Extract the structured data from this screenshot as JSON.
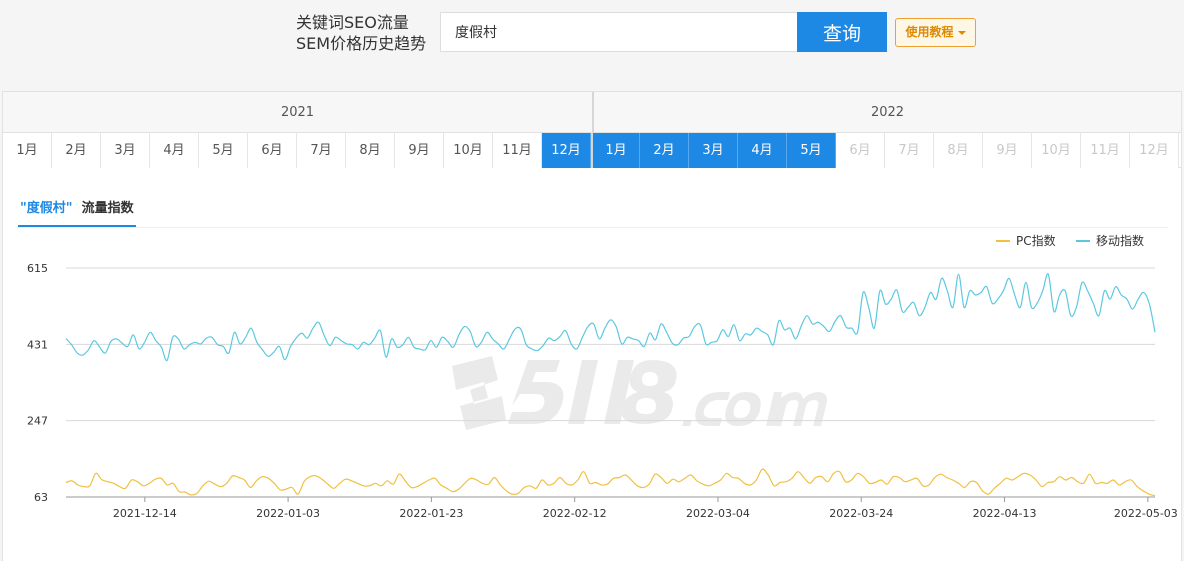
{
  "header": {
    "brand_line1": "关键词SEO流量",
    "brand_line2": "SEM价格历史趋势",
    "search_value": "度假村",
    "search_button": "查询",
    "tutorial_button": "使用教程"
  },
  "timeline": {
    "years": [
      "2021",
      "2022"
    ],
    "months_2021": [
      {
        "label": "1月",
        "state": "normal"
      },
      {
        "label": "2月",
        "state": "normal"
      },
      {
        "label": "3月",
        "state": "normal"
      },
      {
        "label": "4月",
        "state": "normal"
      },
      {
        "label": "5月",
        "state": "normal"
      },
      {
        "label": "6月",
        "state": "normal"
      },
      {
        "label": "7月",
        "state": "normal"
      },
      {
        "label": "8月",
        "state": "normal"
      },
      {
        "label": "9月",
        "state": "normal"
      },
      {
        "label": "10月",
        "state": "normal"
      },
      {
        "label": "11月",
        "state": "normal"
      },
      {
        "label": "12月",
        "state": "active"
      }
    ],
    "months_2022": [
      {
        "label": "1月",
        "state": "active"
      },
      {
        "label": "2月",
        "state": "active"
      },
      {
        "label": "3月",
        "state": "active"
      },
      {
        "label": "4月",
        "state": "active"
      },
      {
        "label": "5月",
        "state": "active"
      },
      {
        "label": "6月",
        "state": "disabled"
      },
      {
        "label": "7月",
        "state": "disabled"
      },
      {
        "label": "8月",
        "state": "disabled"
      },
      {
        "label": "9月",
        "state": "disabled"
      },
      {
        "label": "10月",
        "state": "disabled"
      },
      {
        "label": "11月",
        "state": "disabled"
      },
      {
        "label": "12月",
        "state": "disabled"
      }
    ]
  },
  "tab": {
    "keyword": "\"度假村\"",
    "label": "流量指数"
  },
  "colors": {
    "accent": "#1e88e5",
    "pc": "#f0c040",
    "mobile": "#5bc8e0"
  },
  "chart_data": {
    "type": "line",
    "title": "",
    "xlabel": "",
    "ylabel": "",
    "x_start": "2021-12-03",
    "x_end": "2022-05-04",
    "x_tick_labels": [
      "2021-12-14",
      "2022-01-03",
      "2022-01-23",
      "2022-02-12",
      "2022-03-04",
      "2022-03-24",
      "2022-04-13",
      "2022-05-03"
    ],
    "y_tick_labels": [
      "63",
      "247",
      "431",
      "615"
    ],
    "ylim": [
      63,
      615
    ],
    "grid": true,
    "legend_position": "top-right",
    "series": [
      {
        "name": "PC指数",
        "color": "#f0c040",
        "values": [
          98,
          102,
          92,
          88,
          90,
          120,
          105,
          100,
          96,
          88,
          84,
          104,
          100,
          90,
          96,
          106,
          108,
          92,
          96,
          76,
          75,
          68,
          72,
          90,
          101,
          94,
          88,
          96,
          114,
          110,
          104,
          86,
          102,
          112,
          108,
          96,
          80,
          82,
          86,
          70,
          100,
          112,
          114,
          106,
          94,
          84,
          96,
          106,
          102,
          96,
          90,
          90,
          96,
          90,
          102,
          94,
          118,
          102,
          86,
          88,
          96,
          104,
          108,
          92,
          84,
          76,
          82,
          96,
          108,
          104,
          96,
          94,
          110,
          92,
          78,
          70,
          72,
          86,
          90,
          84,
          104,
          92,
          96,
          110,
          96,
          92,
          104,
          124,
          96,
          98,
          92,
          94,
          108,
          110,
          116,
          104,
          90,
          86,
          94,
          118,
          110,
          96,
          106,
          100,
          108,
          116,
          102,
          94,
          90,
          96,
          104,
          120,
          110,
          108,
          96,
          92,
          104,
          130,
          116,
          90,
          98,
          100,
          108,
          124,
          110,
          96,
          110,
          112,
          100,
          120,
          124,
          100,
          104,
          120,
          112,
          96,
          98,
          104,
          94,
          112,
          110,
          100,
          104,
          108,
          90,
          92,
          110,
          118,
          110,
          104,
          96,
          86,
          100,
          98,
          78,
          70,
          84,
          96,
          108,
          104,
          112,
          120,
          116,
          104,
          88,
          98,
          100,
          112,
          104,
          110,
          100,
          96,
          118,
          96,
          98,
          96,
          104,
          92,
          100,
          104,
          88,
          78,
          70,
          66
        ]
      },
      {
        "name": "移动指数",
        "color": "#5bc8e0",
        "values": [
          445,
          430,
          410,
          405,
          418,
          440,
          424,
          410,
          438,
          444,
          434,
          426,
          454,
          420,
          436,
          460,
          440,
          424,
          392,
          448,
          444,
          420,
          430,
          436,
          432,
          446,
          448,
          430,
          426,
          410,
          460,
          432,
          448,
          470,
          436,
          418,
          402,
          412,
          426,
          394,
          426,
          446,
          458,
          446,
          470,
          484,
          452,
          428,
          448,
          440,
          432,
          430,
          420,
          436,
          430,
          446,
          464,
          400,
          444,
          424,
          430,
          448,
          424,
          420,
          418,
          440,
          424,
          448,
          438,
          424,
          454,
          474,
          462,
          426,
          436,
          460,
          444,
          432,
          420,
          444,
          468,
          468,
          430,
          420,
          416,
          428,
          446,
          440,
          450,
          464,
          432,
          420,
          448,
          474,
          480,
          444,
          470,
          490,
          474,
          432,
          448,
          444,
          440,
          426,
          458,
          442,
          480,
          460,
          434,
          430,
          446,
          450,
          474,
          478,
          432,
          436,
          440,
          466,
          450,
          478,
          440,
          456,
          454,
          470,
          462,
          454,
          430,
          488,
          466,
          470,
          444,
          476,
          500,
          480,
          484,
          474,
          462,
          486,
          500,
          472,
          470,
          460,
          556,
          520,
          470,
          560,
          528,
          540,
          562,
          510,
          520,
          532,
          500,
          520,
          556,
          540,
          590,
          560,
          520,
          600,
          520,
          560,
          550,
          556,
          570,
          530,
          540,
          560,
          590,
          550,
          520,
          580,
          520,
          530,
          560,
          600,
          510,
          550,
          560,
          500,
          520,
          580,
          560,
          530,
          500,
          560,
          540,
          570,
          550,
          540,
          516,
          540,
          556,
          528,
          460
        ]
      }
    ]
  }
}
